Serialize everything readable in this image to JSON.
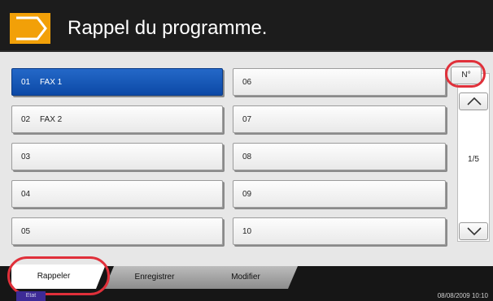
{
  "header": {
    "title": "Rappel du programme.",
    "icon": "program-arrow-icon",
    "accent_color": "#f2a008"
  },
  "programs": [
    {
      "num": "01",
      "label": "FAX 1",
      "selected": true
    },
    {
      "num": "02",
      "label": "FAX 2",
      "selected": false
    },
    {
      "num": "03",
      "label": "",
      "selected": false
    },
    {
      "num": "04",
      "label": "",
      "selected": false
    },
    {
      "num": "05",
      "label": "",
      "selected": false
    },
    {
      "num": "06",
      "label": "",
      "selected": false
    },
    {
      "num": "07",
      "label": "",
      "selected": false
    },
    {
      "num": "08",
      "label": "",
      "selected": false
    },
    {
      "num": "09",
      "label": "",
      "selected": false
    },
    {
      "num": "10",
      "label": "",
      "selected": false
    }
  ],
  "pager": {
    "sort_label": "N°",
    "page_indicator": "1/5",
    "up_icon": "chevron-up-icon",
    "down_icon": "chevron-down-icon"
  },
  "footer": {
    "tabs": [
      {
        "label": "Rappeler",
        "active": true
      },
      {
        "label": "Enregistrer",
        "active": false
      },
      {
        "label": "Modifier",
        "active": false
      }
    ],
    "status_label": "Etat",
    "datetime": "08/08/2009    10:10"
  },
  "highlight_color": "#e0303a",
  "selected_color": "#1458b8"
}
